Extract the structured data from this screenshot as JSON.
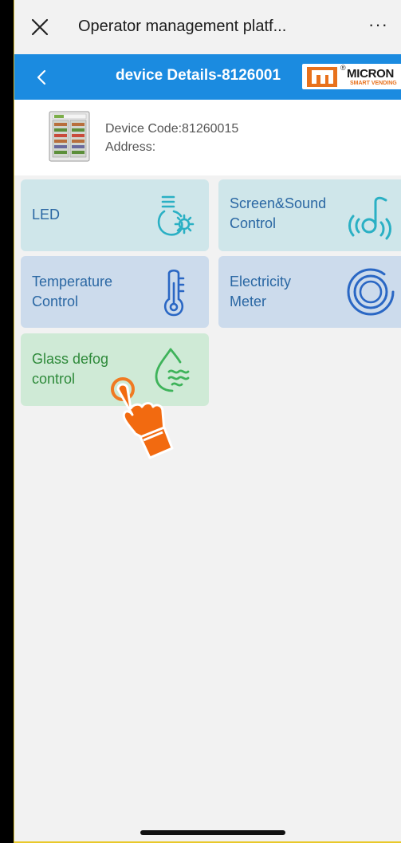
{
  "window": {
    "title": "Operator management platf...",
    "close_icon": "close-icon",
    "more_label": "···"
  },
  "header": {
    "title": "device Details-8126001",
    "back_icon": "chevron-left-icon",
    "logo": {
      "word": "MICRON",
      "sub": "SMART VENDING",
      "reg": "®"
    },
    "background": "#1b8be0"
  },
  "device": {
    "code_line": "Device Code:81260015",
    "address_line": "Address:"
  },
  "tiles": [
    {
      "label": "LED",
      "icon": "bulb-gear-icon",
      "color": "#cfe6ea"
    },
    {
      "label": "Screen&Sound\nControl",
      "icon": "sound-note-icon",
      "color": "#cfe6ea"
    },
    {
      "label": "Temperature\nControl",
      "icon": "thermometer-icon",
      "color": "#ccdbec"
    },
    {
      "label": "Electricity\nMeter",
      "icon": "meter-rings-icon",
      "color": "#ccdbec"
    },
    {
      "label": "Glass defog\ncontrol",
      "icon": "water-drop-waves-icon",
      "color": "#cfead6"
    }
  ],
  "overlay": {
    "icon": "tap-hand-icon"
  }
}
